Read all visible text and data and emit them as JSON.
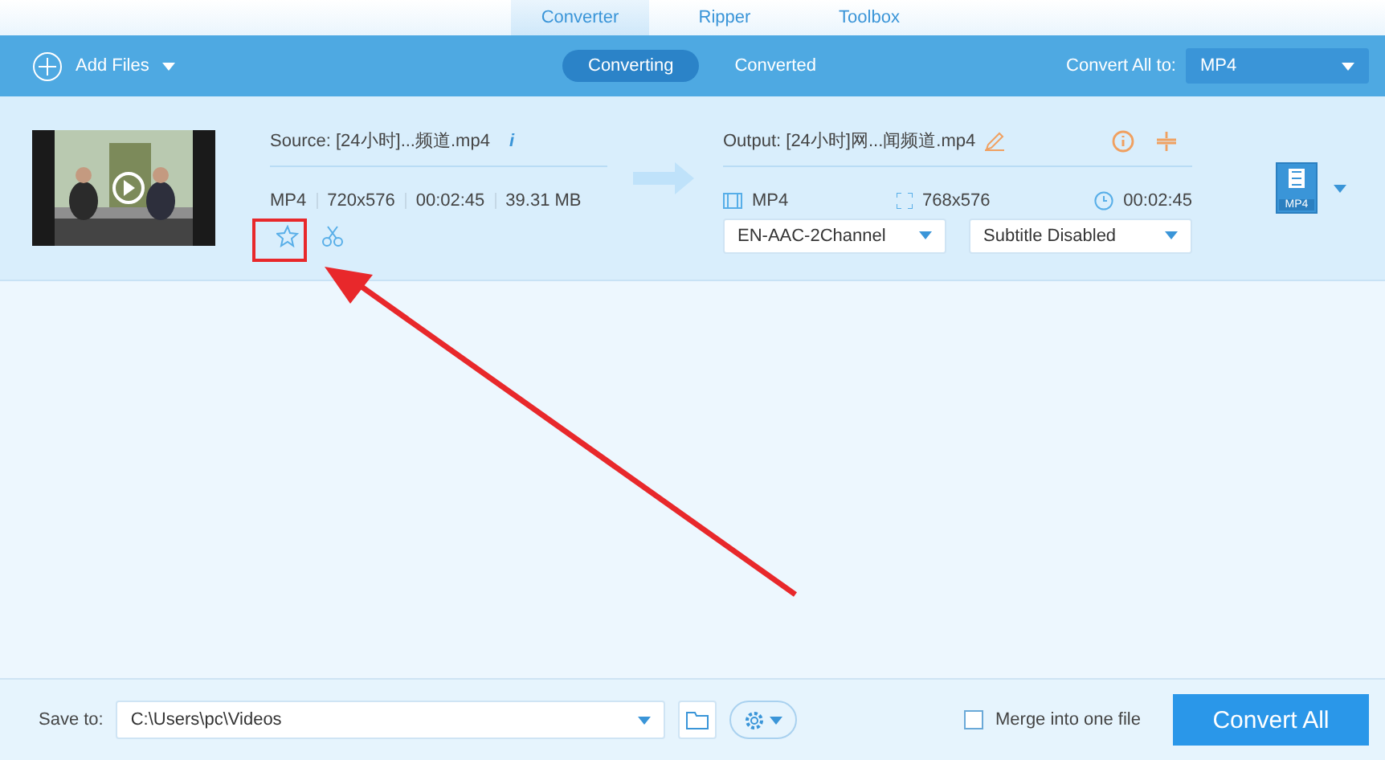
{
  "tabs": [
    {
      "label": "Converter",
      "selected": true
    },
    {
      "label": "Ripper",
      "selected": false
    },
    {
      "label": "Toolbox",
      "selected": false
    }
  ],
  "toolbar": {
    "add_files": "Add Files",
    "views": [
      {
        "label": "Converting",
        "selected": true
      },
      {
        "label": "Converted",
        "selected": false
      }
    ],
    "convert_all_label": "Convert All to:",
    "convert_all_format": "MP4"
  },
  "file": {
    "source": "Source: [24小时]...频道.mp4",
    "info": "i",
    "source_meta": [
      "MP4",
      "720x576",
      "00:02:45",
      "39.31 MB"
    ],
    "output": "Output: [24小时]网...闻频道.mp4",
    "output_format": "MP4",
    "output_resolution": "768x576",
    "output_duration": "00:02:45",
    "audio": "EN-AAC-2Channel",
    "subtitle": "Subtitle Disabled",
    "format_badge": "MP4"
  },
  "bottom": {
    "save_to_label": "Save to:",
    "save_path": "C:\\Users\\pc\\Videos",
    "merge_label": "Merge into one file",
    "merge_checked": false,
    "convert_button": "Convert All"
  }
}
